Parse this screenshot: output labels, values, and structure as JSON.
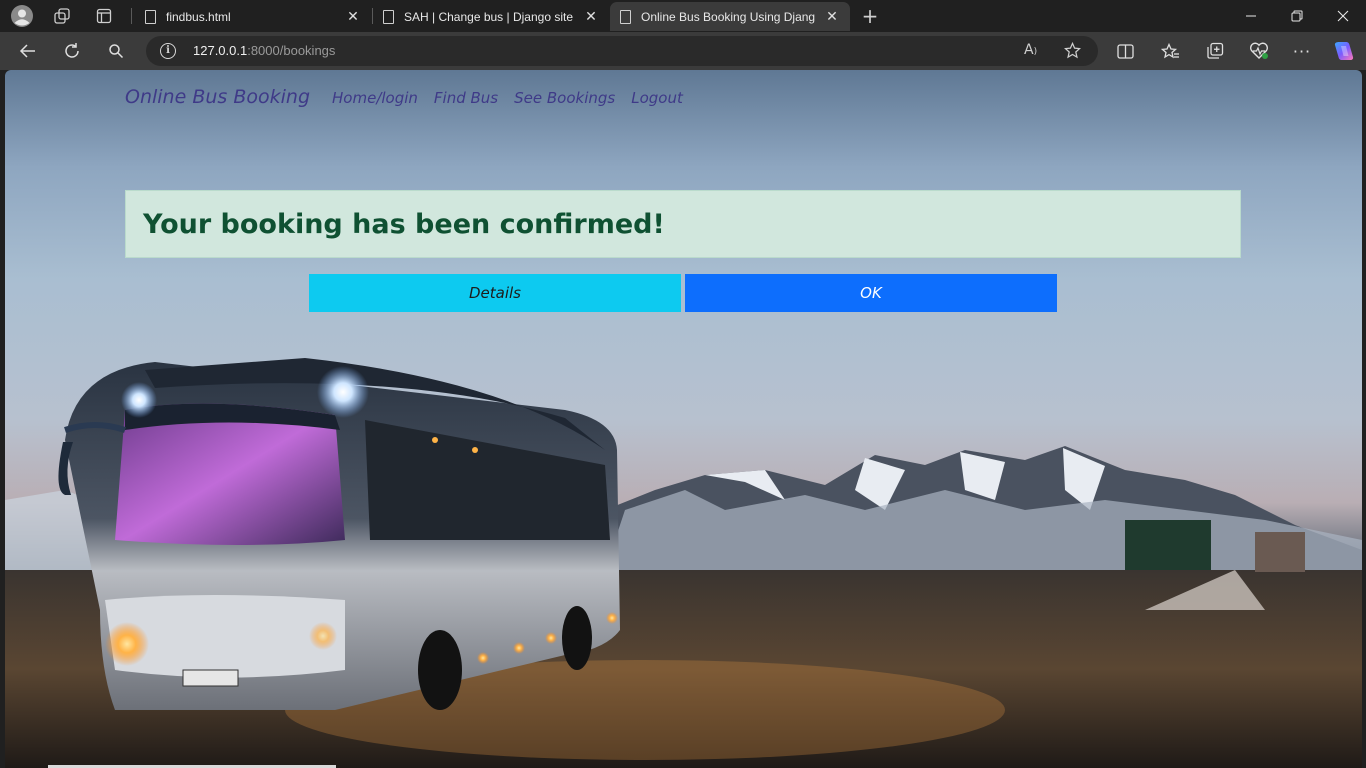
{
  "browser": {
    "tabs": [
      {
        "title": "findbus.html",
        "active": false
      },
      {
        "title": "SAH | Change bus | Django site a",
        "active": false
      },
      {
        "title": "Online Bus Booking Using Djang",
        "active": true
      }
    ],
    "new_tab_label": "+",
    "address": {
      "host": "127.0.0.1",
      "rest": ":8000/bookings"
    },
    "icons": [
      "profile-icon",
      "workspaces-icon",
      "tab-actions-icon",
      "back-icon",
      "refresh-icon",
      "search-icon",
      "site-info-icon",
      "read-aloud-icon",
      "favorite-star-icon",
      "split-screen-icon",
      "favorites-icon",
      "collections-icon",
      "browser-essentials-icon",
      "more-icon",
      "copilot-icon",
      "minimize-icon",
      "maximize-icon",
      "close-icon"
    ]
  },
  "page": {
    "brand": "Online Bus Booking",
    "nav": [
      "Home/login",
      "Find Bus",
      "See Bookings",
      "Logout"
    ],
    "alert": "Your booking has been confirmed!",
    "buttons": {
      "details": "Details",
      "ok": "OK"
    },
    "colors": {
      "alert_bg": "#d1e7dd",
      "alert_text": "#0f5132",
      "details_bg": "#0dcaf0",
      "ok_bg": "#0d6efd",
      "nav_text": "#3f3a88"
    }
  }
}
